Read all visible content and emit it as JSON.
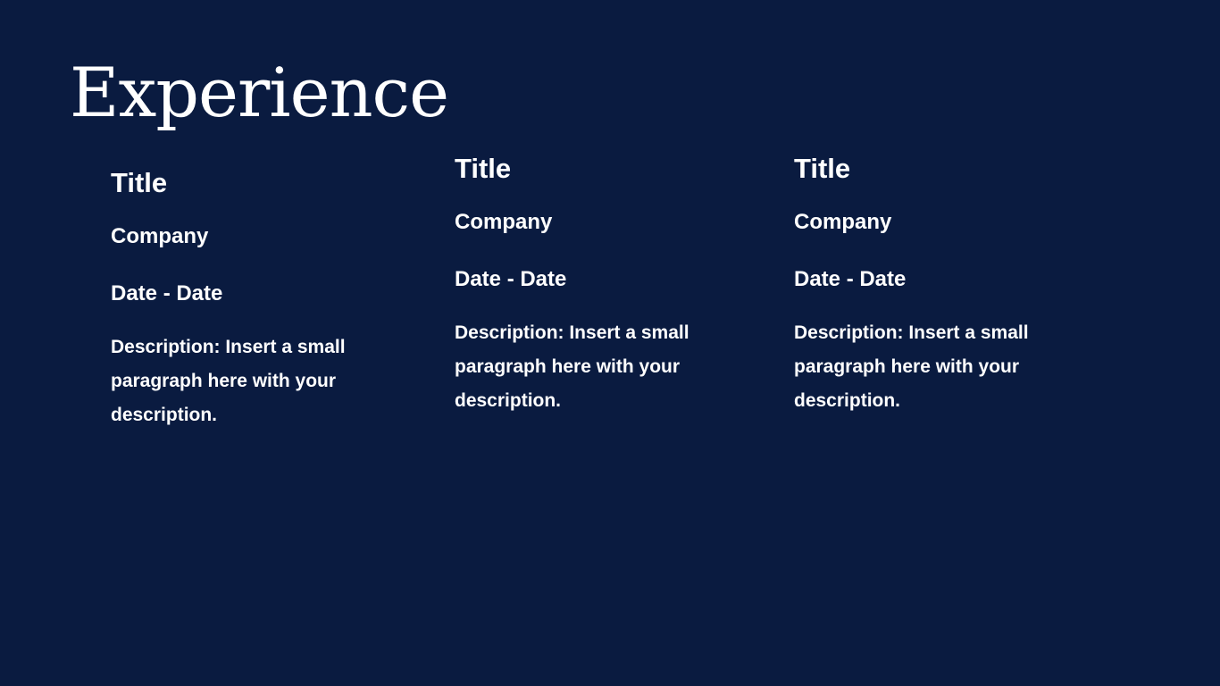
{
  "page": {
    "title": "Experience",
    "background": "#0a1b40",
    "text_color": "#ffffff"
  },
  "entries": [
    {
      "title": "Title",
      "company": "Company",
      "dates": "Date - Date",
      "description": "Description: Insert a small paragraph here with your description."
    },
    {
      "title": "Title",
      "company": "Company",
      "dates": "Date - Date",
      "description": "Description: Insert a small paragraph here with your description."
    },
    {
      "title": "Title",
      "company": "Company",
      "dates": "Date - Date",
      "description": "Description: Insert a small paragraph here with your description."
    }
  ]
}
